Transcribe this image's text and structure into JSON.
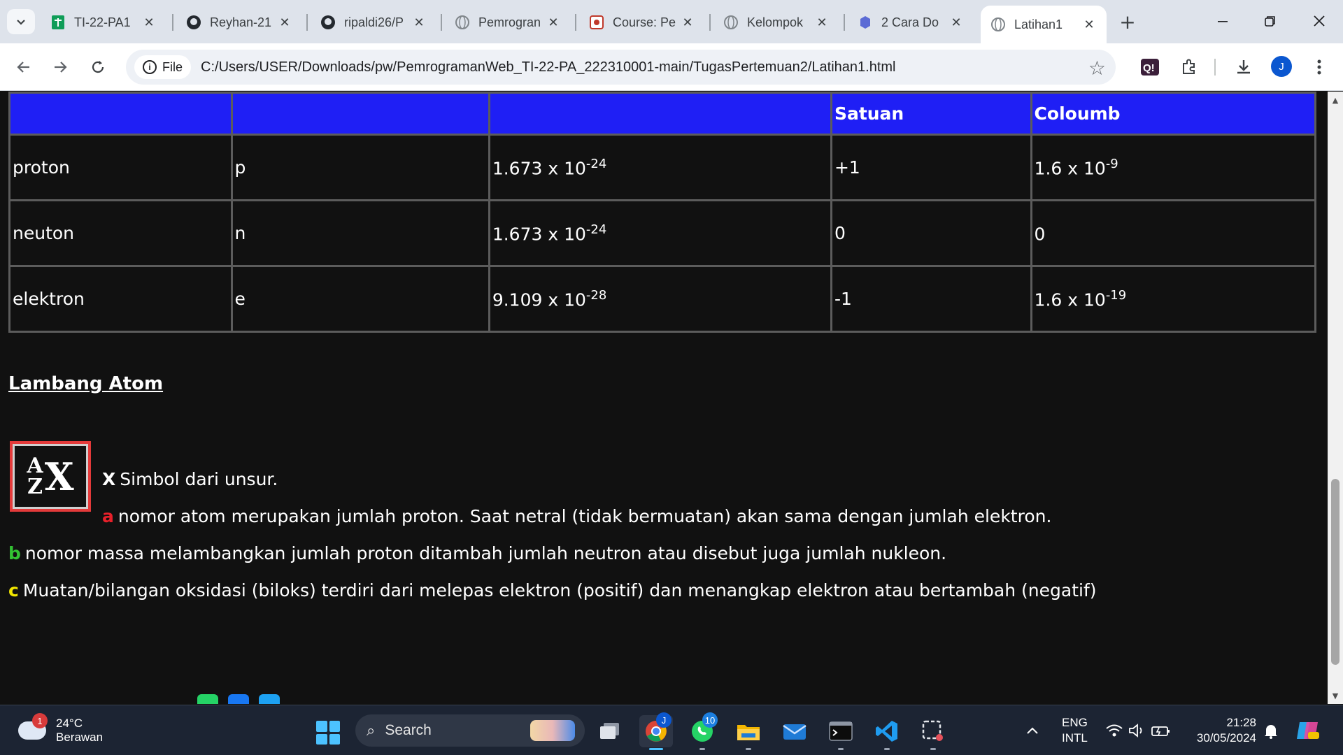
{
  "browser": {
    "tabs": [
      {
        "title": "TI-22-PA1",
        "icon": "sheets-icon"
      },
      {
        "title": "Reyhan-21",
        "icon": "github-icon"
      },
      {
        "title": "ripaldi26/P",
        "icon": "github-icon"
      },
      {
        "title": "Pemrogran",
        "icon": "globe-icon"
      },
      {
        "title": "Course: Pe",
        "icon": "course-icon"
      },
      {
        "title": "Kelompok",
        "icon": "globe-icon"
      },
      {
        "title": "2 Cara Do",
        "icon": "site-icon"
      },
      {
        "title": "Latihan1",
        "icon": "globe-icon",
        "active": true
      }
    ],
    "omnibox": {
      "chip_label": "File",
      "url": "C:/Users/USER/Downloads/pw/PemrogramanWeb_TI-22-PA_222310001-main/TugasPertemuan2/Latihan1.html"
    },
    "profile_initial": "J"
  },
  "page": {
    "table": {
      "headers": [
        "",
        "",
        "",
        "Satuan",
        "Coloumb"
      ],
      "rows": [
        {
          "name": "proton",
          "symbol": "p",
          "mass_base": "1.673 x 10",
          "mass_exp": "-24",
          "charge": "+1",
          "coulomb_base": "1.6 x 10",
          "coulomb_exp": "-9"
        },
        {
          "name": "neuton",
          "symbol": "n",
          "mass_base": "1.673 x 10",
          "mass_exp": "-24",
          "charge": "0",
          "coulomb_base": "0",
          "coulomb_exp": ""
        },
        {
          "name": "elektron",
          "symbol": "e",
          "mass_base": "9.109 x 10",
          "mass_exp": "-28",
          "charge": "-1",
          "coulomb_base": "1.6 x 10",
          "coulomb_exp": "-19"
        }
      ]
    },
    "section_title": "Lambang Atom",
    "notation": {
      "top": "A",
      "bottom": "Z",
      "big": "X"
    },
    "paragraphs": [
      {
        "lead": "X",
        "lead_color": "#ffffff",
        "text": "Simbol dari unsur."
      },
      {
        "lead": "a",
        "lead_color": "#e8202a",
        "text": "nomor atom merupakan jumlah proton. Saat netral (tidak bermuatan) akan sama dengan jumlah elektron."
      },
      {
        "lead": "b",
        "lead_color": "#33c233",
        "text": "nomor massa melambangkan jumlah proton ditambah jumlah neutron atau disebut juga jumlah nukleon."
      },
      {
        "lead": "c",
        "lead_color": "#f2e600",
        "text": "Muatan/bilangan oksidasi (biloks) terdiri dari melepas elektron (positif) dan menangkap elektron atau bertambah (negatif)"
      }
    ]
  },
  "taskbar": {
    "weather": {
      "temp": "24°C",
      "condition": "Berawan",
      "badge": "1"
    },
    "search_label": "Search",
    "whatsapp_badge": "10",
    "chrome_badge": "J",
    "lang": {
      "line1": "ENG",
      "line2": "INTL"
    },
    "clock": {
      "time": "21:28",
      "date": "30/05/2024"
    }
  },
  "colors": {
    "table_header": "#1f1ff5",
    "page_bg": "#111111",
    "accent": "#4cc2ff"
  }
}
